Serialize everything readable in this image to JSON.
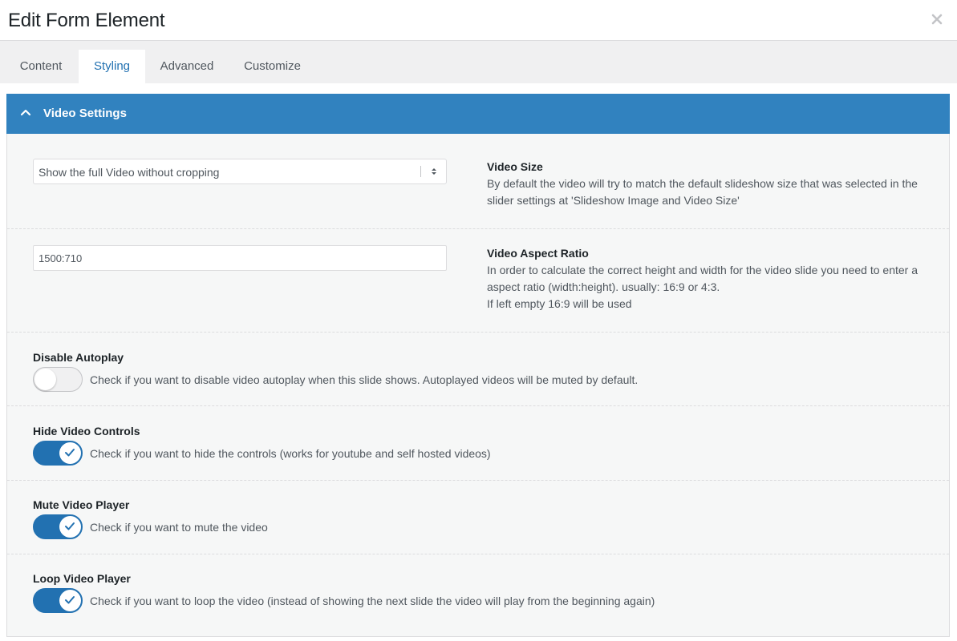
{
  "dialog": {
    "title": "Edit Form Element",
    "close_icon": "close-icon"
  },
  "tabs": [
    {
      "label": "Content"
    },
    {
      "label": "Styling"
    },
    {
      "label": "Advanced"
    },
    {
      "label": "Customize"
    }
  ],
  "active_tab": "Styling",
  "panel": {
    "title": "Video Settings",
    "header_color": "#3182bf"
  },
  "video_size": {
    "title": "Video Size",
    "selected": "Show the full Video without cropping",
    "description": "By default the video will try to match the default slideshow size that was selected in the slider settings at 'Slideshow Image and Video Size'"
  },
  "aspect_ratio": {
    "title": "Video Aspect Ratio",
    "value": "1500:710",
    "description_line1": "In order to calculate the correct height and width for the video slide you need to enter a aspect ratio (width:height). usually: 16:9 or 4:3.",
    "description_line2": "If left empty 16:9 will be used"
  },
  "toggles": [
    {
      "label": "Disable Autoplay",
      "description": "Check if you want to disable video autoplay when this slide shows. Autoplayed videos will be muted by default.",
      "checked": false
    },
    {
      "label": "Hide Video Controls",
      "description": "Check if you want to hide the controls (works for youtube and self hosted videos)",
      "checked": true
    },
    {
      "label": "Mute Video Player",
      "description": "Check if you want to mute the video",
      "checked": true
    },
    {
      "label": "Loop Video Player",
      "description": "Check if you want to loop the video (instead of showing the next slide the video will play from the beginning again)",
      "checked": true
    }
  ],
  "colors": {
    "accent": "#2271b1",
    "panel_background": "#f6f7f7"
  }
}
